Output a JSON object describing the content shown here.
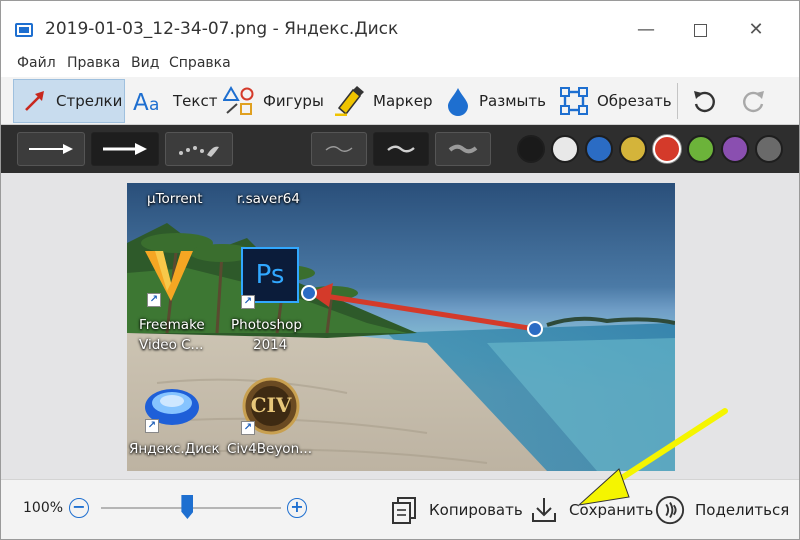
{
  "window": {
    "title": "2019-01-03_12-34-07.png - Яндекс.Диск",
    "minimize_glyph": "—",
    "close_glyph": "✕"
  },
  "menu": {
    "items": [
      "Файл",
      "Правка",
      "Вид",
      "Справка"
    ]
  },
  "toolbar": {
    "tools": [
      {
        "label": "Стрелки",
        "icon": "arrow-tool-icon",
        "active": true
      },
      {
        "label": "Текст",
        "icon": "text-tool-icon",
        "active": false
      },
      {
        "label": "Фигуры",
        "icon": "shapes-tool-icon",
        "active": false
      },
      {
        "label": "Маркер",
        "icon": "marker-tool-icon",
        "active": false
      },
      {
        "label": "Размыть",
        "icon": "blur-tool-icon",
        "active": false
      },
      {
        "label": "Обрезать",
        "icon": "crop-tool-icon",
        "active": false
      }
    ],
    "undo_icon": "undo-icon",
    "redo_icon": "redo-icon"
  },
  "options": {
    "arrow_styles": [
      "arrow-style-thin",
      "arrow-style-bold",
      "arrow-style-dotted"
    ],
    "selected_arrow_style": 1,
    "stroke_styles": [
      "stroke-thin",
      "stroke-medium",
      "stroke-thick"
    ],
    "selected_stroke": 1,
    "colors": [
      "#1a1a1a",
      "#e8e8e8",
      "#2b6cc4",
      "#d4b43a",
      "#d43a2a",
      "#6cb33a",
      "#8a4fb0",
      "#6a6a6a"
    ],
    "selected_color": 4
  },
  "canvas": {
    "desktop_labels": {
      "utorrent": "µTorrent",
      "rsaver": "r.saver64",
      "freemake_1": "Freemake",
      "freemake_2": "Video C...",
      "photoshop_1": "Photoshop",
      "photoshop_2": "2014",
      "yandex_disk": "Яндекс.Диск",
      "civ": "Civ4Beyon..."
    },
    "ps_icon_text": "Ps",
    "civ_icon_text": "CIV",
    "annotation_arrow_color": "#d43a2a",
    "handle_color": "#2b6cc4"
  },
  "bottom": {
    "zoom_text": "100%",
    "zoom_minus": "−",
    "zoom_plus": "+",
    "zoom_level_fraction": 0.48,
    "copy_label": "Копировать",
    "save_label": "Сохранить",
    "share_label": "Поделиться"
  },
  "callout": {
    "arrow_color": "#f5f500"
  }
}
